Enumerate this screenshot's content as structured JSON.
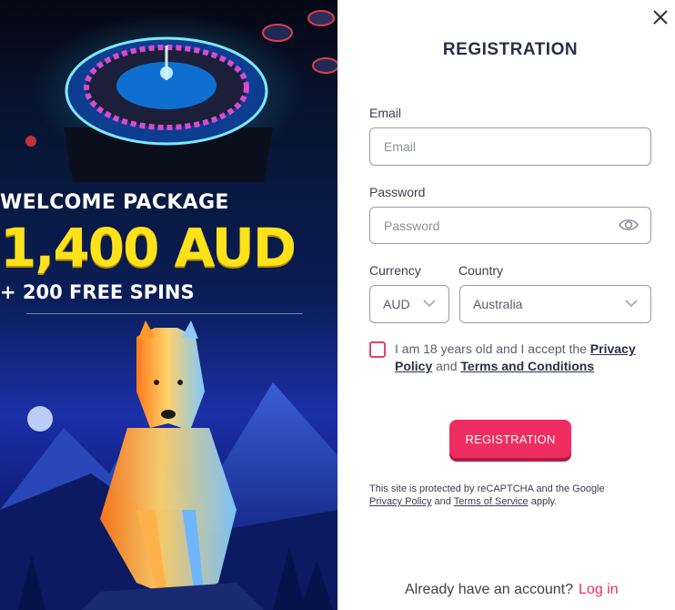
{
  "promo": {
    "title": "WELCOME PACKAGE",
    "amount": "1,400 AUD",
    "spins": "+ 200 FREE SPINS"
  },
  "form": {
    "title": "REGISTRATION",
    "email_label": "Email",
    "email_placeholder": "Email",
    "password_label": "Password",
    "password_placeholder": "Password",
    "currency_label": "Currency",
    "currency_value": "AUD",
    "country_label": "Country",
    "country_value": "Australia",
    "consent_prefix": "I am 18 years old and I accept the",
    "consent_link1": "Privacy Policy",
    "consent_and": "and",
    "consent_link2": "Terms and Conditions",
    "submit_label": "REGISTRATION",
    "recaptcha_prefix": "This site is protected by reCAPTCHA and the Google",
    "recaptcha_privacy": "Privacy Policy",
    "recaptcha_and": "and",
    "recaptcha_terms": "Terms of Service",
    "recaptcha_suffix": "apply.",
    "footer_text": "Already have an account?",
    "footer_link": "Log in"
  },
  "colors": {
    "accent": "#ef2d61",
    "promo_amount": "#ffe21a",
    "title": "#2b2e4a"
  },
  "icons": {
    "close": "close-icon",
    "eye": "eye-icon",
    "chevron": "chevron-down-icon"
  }
}
